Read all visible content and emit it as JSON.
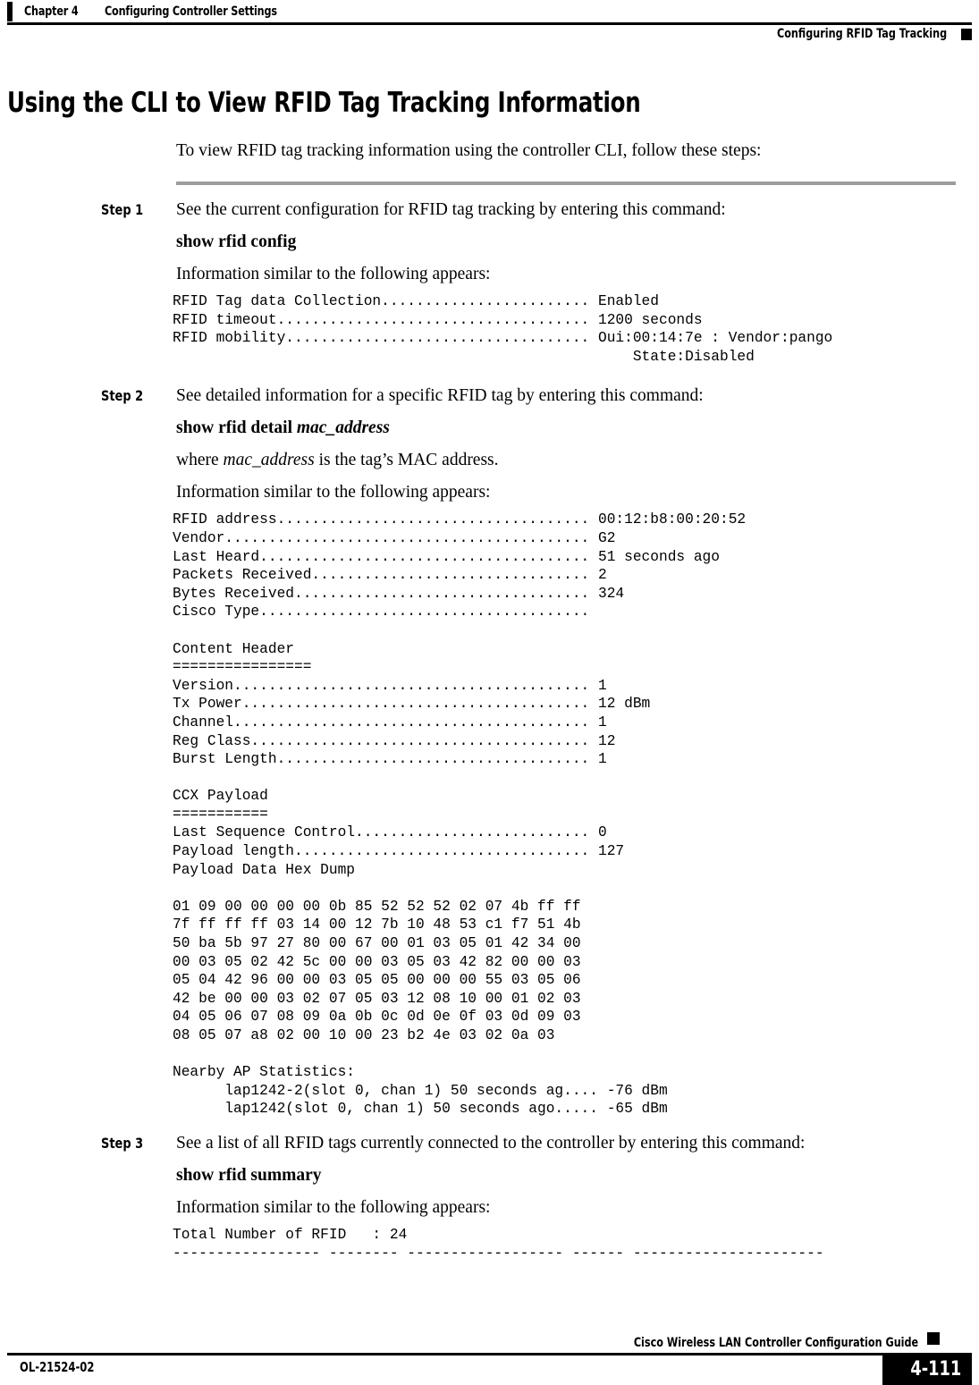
{
  "header": {
    "chapter_number": "Chapter 4",
    "chapter_title": "Configuring Controller Settings",
    "section_title": "Configuring RFID Tag Tracking"
  },
  "title": "Using the CLI to View RFID Tag Tracking Information",
  "intro": "To view RFID tag tracking information using the controller CLI, follow these steps:",
  "steps": [
    {
      "label": "Step 1",
      "text": "See the current configuration for RFID tag tracking by entering this command:",
      "command": "show rfid config",
      "command_arg": "",
      "result_intro": "Information similar to the following appears:",
      "output": "RFID Tag data Collection........................ Enabled\nRFID timeout.................................... 1200 seconds\nRFID mobility................................... Oui:00:14:7e : Vendor:pango\n                                                     State:Disabled"
    },
    {
      "label": "Step 2",
      "text": "See detailed information for a specific RFID tag by entering this command:",
      "command": "show rfid detail",
      "command_arg": "mac_address",
      "where_prefix": "where ",
      "where_arg": "mac_address",
      "where_suffix": " is the tag’s MAC address.",
      "result_intro": "Information similar to the following appears:",
      "output": "RFID address.................................... 00:12:b8:00:20:52\nVendor.......................................... G2\nLast Heard...................................... 51 seconds ago\nPackets Received................................ 2\nBytes Received.................................. 324\nCisco Type......................................\n\nContent Header\n================\nVersion......................................... 1\nTx Power........................................ 12 dBm\nChannel......................................... 1\nReg Class....................................... 12\nBurst Length.................................... 1\n\nCCX Payload\n===========\nLast Sequence Control........................... 0\nPayload length.................................. 127\nPayload Data Hex Dump\n\n01 09 00 00 00 00 0b 85 52 52 52 02 07 4b ff ff\n7f ff ff ff 03 14 00 12 7b 10 48 53 c1 f7 51 4b\n50 ba 5b 97 27 80 00 67 00 01 03 05 01 42 34 00\n00 03 05 02 42 5c 00 00 03 05 03 42 82 00 00 03\n05 04 42 96 00 00 03 05 05 00 00 00 55 03 05 06\n42 be 00 00 03 02 07 05 03 12 08 10 00 01 02 03\n04 05 06 07 08 09 0a 0b 0c 0d 0e 0f 03 0d 09 03\n08 05 07 a8 02 00 10 00 23 b2 4e 03 02 0a 03\n\nNearby AP Statistics:\n      lap1242-2(slot 0, chan 1) 50 seconds ag.... -76 dBm\n      lap1242(slot 0, chan 1) 50 seconds ago..... -65 dBm"
    },
    {
      "label": "Step 3",
      "text": "See a list of all RFID tags currently connected to the controller by entering this command:",
      "command": "show rfid summary",
      "command_arg": "",
      "result_intro": "Information similar to the following appears:",
      "output": "Total Number of RFID   : 24\n----------------- -------- ------------------ ------ ----------------------"
    }
  ],
  "footer": {
    "guide_title": "Cisco Wireless LAN Controller Configuration Guide",
    "doc_id": "OL-21524-02",
    "page_number": "4-111"
  }
}
